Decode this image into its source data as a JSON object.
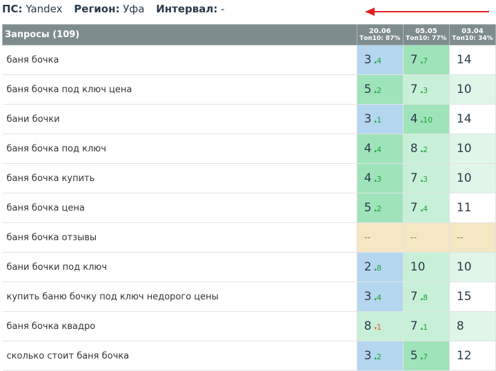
{
  "header": {
    "ps_label": "ПС:",
    "ps_value": "Yandex",
    "region_label": "Регион:",
    "region_value": "Уфа",
    "interval_label": "Интервал:",
    "interval_value": "-"
  },
  "colors": {
    "blue": "#b4d6ef",
    "green": "#9fe3bb",
    "light_green": "#c8f0d8",
    "pale_green": "#dff6e8",
    "white": "#ffffff",
    "beige": "#f5e6c4",
    "arrow": "#e02020"
  },
  "table": {
    "query_header": "Запросы (109)",
    "columns": [
      {
        "date": "20.06",
        "top": "Топ10: 87%"
      },
      {
        "date": "05.05",
        "top": "Топ10: 77%"
      },
      {
        "date": "03.04",
        "top": "Топ10: 34%"
      }
    ],
    "rows": [
      {
        "query": "баня бочка",
        "cells": [
          {
            "pos": "3",
            "delta": "4",
            "dir": "up",
            "bg": "blue"
          },
          {
            "pos": "7",
            "delta": "7",
            "dir": "up",
            "bg": "green"
          },
          {
            "pos": "14",
            "delta": "",
            "dir": "",
            "bg": "white"
          }
        ]
      },
      {
        "query": "баня бочка под ключ цена",
        "cells": [
          {
            "pos": "5",
            "delta": "2",
            "dir": "up",
            "bg": "green"
          },
          {
            "pos": "7",
            "delta": "3",
            "dir": "up",
            "bg": "light_green"
          },
          {
            "pos": "10",
            "delta": "",
            "dir": "",
            "bg": "pale_green"
          }
        ]
      },
      {
        "query": "бани бочки",
        "cells": [
          {
            "pos": "3",
            "delta": "1",
            "dir": "up",
            "bg": "blue"
          },
          {
            "pos": "4",
            "delta": "10",
            "dir": "up",
            "bg": "green"
          },
          {
            "pos": "14",
            "delta": "",
            "dir": "",
            "bg": "white"
          }
        ]
      },
      {
        "query": "баня бочка под ключ",
        "cells": [
          {
            "pos": "4",
            "delta": "4",
            "dir": "up",
            "bg": "green"
          },
          {
            "pos": "8",
            "delta": "2",
            "dir": "up",
            "bg": "light_green"
          },
          {
            "pos": "10",
            "delta": "",
            "dir": "",
            "bg": "pale_green"
          }
        ]
      },
      {
        "query": "баня бочка купить",
        "cells": [
          {
            "pos": "4",
            "delta": "3",
            "dir": "up",
            "bg": "green"
          },
          {
            "pos": "7",
            "delta": "3",
            "dir": "up",
            "bg": "light_green"
          },
          {
            "pos": "10",
            "delta": "",
            "dir": "",
            "bg": "pale_green"
          }
        ]
      },
      {
        "query": "баня бочка цена",
        "cells": [
          {
            "pos": "5",
            "delta": "2",
            "dir": "up",
            "bg": "green"
          },
          {
            "pos": "7",
            "delta": "4",
            "dir": "up",
            "bg": "light_green"
          },
          {
            "pos": "11",
            "delta": "",
            "dir": "",
            "bg": "white"
          }
        ]
      },
      {
        "query": "баня бочка отзывы",
        "cells": [
          {
            "pos": "--",
            "delta": "",
            "dir": "",
            "bg": "beige"
          },
          {
            "pos": "--",
            "delta": "",
            "dir": "",
            "bg": "beige"
          },
          {
            "pos": "--",
            "delta": "",
            "dir": "",
            "bg": "beige"
          }
        ]
      },
      {
        "query": "бани бочки под ключ",
        "cells": [
          {
            "pos": "2",
            "delta": "8",
            "dir": "up",
            "bg": "blue"
          },
          {
            "pos": "10",
            "delta": "",
            "dir": "",
            "bg": "light_green"
          },
          {
            "pos": "10",
            "delta": "",
            "dir": "",
            "bg": "pale_green"
          }
        ]
      },
      {
        "query": "купить баню бочку под ключ недорого цены",
        "cells": [
          {
            "pos": "3",
            "delta": "4",
            "dir": "up",
            "bg": "blue"
          },
          {
            "pos": "7",
            "delta": "8",
            "dir": "up",
            "bg": "light_green"
          },
          {
            "pos": "15",
            "delta": "",
            "dir": "",
            "bg": "white"
          }
        ]
      },
      {
        "query": "баня бочка квадро",
        "cells": [
          {
            "pos": "8",
            "delta": "1",
            "dir": "down",
            "bg": "light_green"
          },
          {
            "pos": "7",
            "delta": "1",
            "dir": "up",
            "bg": "light_green"
          },
          {
            "pos": "8",
            "delta": "",
            "dir": "",
            "bg": "pale_green"
          }
        ]
      },
      {
        "query": "сколько стоит баня бочка",
        "cells": [
          {
            "pos": "3",
            "delta": "2",
            "dir": "up",
            "bg": "blue"
          },
          {
            "pos": "5",
            "delta": "7",
            "dir": "up",
            "bg": "green"
          },
          {
            "pos": "12",
            "delta": "",
            "dir": "",
            "bg": "white"
          }
        ]
      }
    ]
  }
}
